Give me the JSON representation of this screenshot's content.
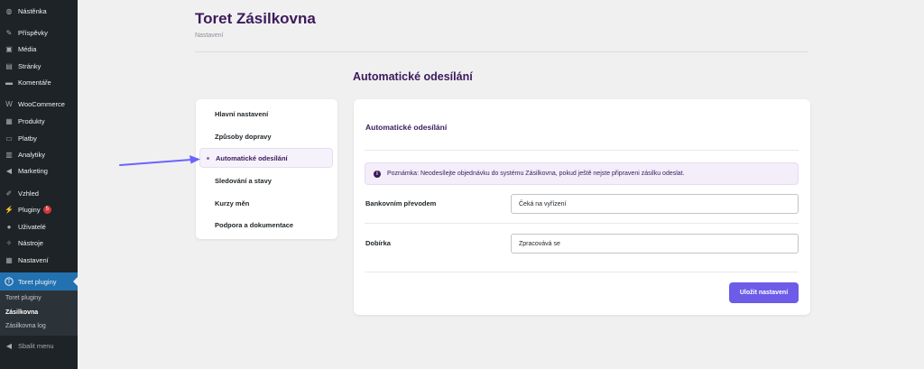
{
  "sidebar": {
    "items": [
      {
        "label": "Nástěnka",
        "icon": "dashboard-icon",
        "glyph": "◍"
      },
      {
        "label": "Příspěvky",
        "icon": "pin-icon",
        "glyph": "✎"
      },
      {
        "label": "Média",
        "icon": "media-icon",
        "glyph": "▣"
      },
      {
        "label": "Stránky",
        "icon": "pages-icon",
        "glyph": "▤"
      },
      {
        "label": "Komentáře",
        "icon": "comments-icon",
        "glyph": "▬"
      },
      {
        "label": "WooCommerce",
        "icon": "woocommerce-icon",
        "glyph": "W"
      },
      {
        "label": "Produkty",
        "icon": "products-icon",
        "glyph": "▦"
      },
      {
        "label": "Platby",
        "icon": "payments-icon",
        "glyph": "▭"
      },
      {
        "label": "Analytiky",
        "icon": "analytics-icon",
        "glyph": "▥"
      },
      {
        "label": "Marketing",
        "icon": "megaphone-icon",
        "glyph": "◀"
      },
      {
        "label": "Vzhled",
        "icon": "brush-icon",
        "glyph": "✐"
      },
      {
        "label": "Pluginy",
        "icon": "plugins-icon",
        "glyph": "⚡",
        "badge": "5"
      },
      {
        "label": "Uživatelé",
        "icon": "users-icon",
        "glyph": "●"
      },
      {
        "label": "Nástroje",
        "icon": "tools-icon",
        "glyph": "✧"
      },
      {
        "label": "Nastavení",
        "icon": "settings-icon",
        "glyph": "▦"
      },
      {
        "label": "Toret pluginy",
        "icon": "toret-logo-icon",
        "glyph": "T"
      }
    ],
    "submenu": [
      "Toret pluginy",
      "Zásilkovna",
      "Zásilkovna log"
    ],
    "collapse_label": "Sbalit menu"
  },
  "header": {
    "title": "Toret Zásilkovna",
    "breadcrumb": "Nastavení"
  },
  "section_title": "Automatické odesílání",
  "nav": {
    "items": [
      "Hlavní nastavení",
      "Způsoby dopravy",
      "Automatické odesílání",
      "Sledování a stavy",
      "Kurzy měn",
      "Podpora a dokumentace"
    ],
    "active": "Automatické odesílání"
  },
  "card": {
    "title": "Automatické odesílání",
    "notice": "Poznámka: Neodesílejte objednávku do systému Zásilkovna, pokud ještě nejste připraveni zásilku odeslat.",
    "rows": [
      {
        "label": "Bankovním převodem",
        "value": "Čeká na vyřízení"
      },
      {
        "label": "Dobírka",
        "value": "Zpracovává se"
      }
    ],
    "save_label": "Uložit nastavení"
  },
  "colors": {
    "sidebar_bg": "#1d2327",
    "active_blue": "#2271b1",
    "brand_purple": "#3c1a5b",
    "button_purple": "#6c5ce7",
    "arrow": "#6c63ff"
  }
}
